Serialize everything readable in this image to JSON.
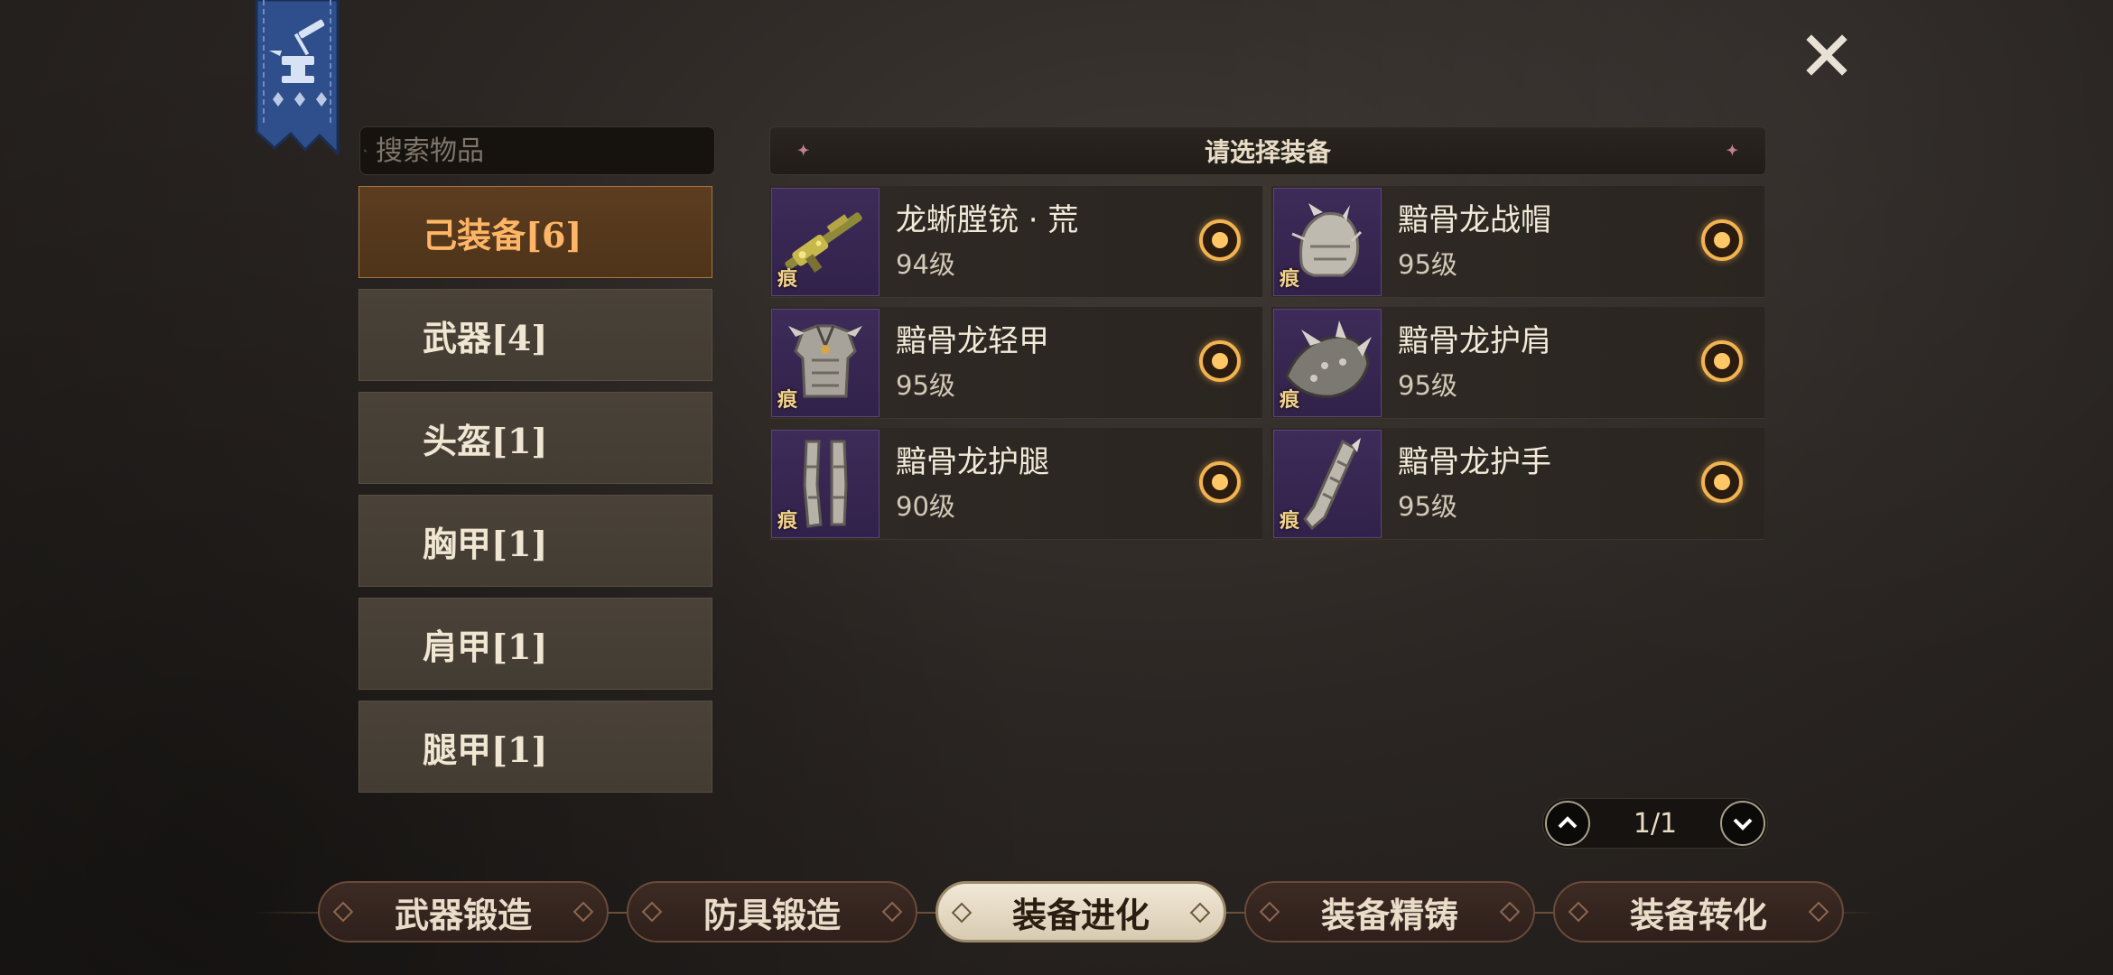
{
  "search": {
    "placeholder": "搜索物品"
  },
  "categories": [
    {
      "label": "己装备[6]",
      "active": true
    },
    {
      "label": "武器[4]",
      "active": false
    },
    {
      "label": "头盔[1]",
      "active": false
    },
    {
      "label": "胸甲[1]",
      "active": false
    },
    {
      "label": "肩甲[1]",
      "active": false
    },
    {
      "label": "腿甲[1]",
      "active": false
    }
  ],
  "list": {
    "header": "请选择装备",
    "items": [
      {
        "name": "龙蜥膛铳 · 荒",
        "level": "94级",
        "mark": "痕",
        "icon": "rifle-icon"
      },
      {
        "name": "黯骨龙战帽",
        "level": "95级",
        "mark": "痕",
        "icon": "helmet-icon"
      },
      {
        "name": "黯骨龙轻甲",
        "level": "95级",
        "mark": "痕",
        "icon": "chest-armor-icon"
      },
      {
        "name": "黯骨龙护肩",
        "level": "95级",
        "mark": "痕",
        "icon": "pauldron-icon"
      },
      {
        "name": "黯骨龙护腿",
        "level": "90级",
        "mark": "痕",
        "icon": "leg-armor-icon"
      },
      {
        "name": "黯骨龙护手",
        "level": "95级",
        "mark": "痕",
        "icon": "gauntlet-icon"
      }
    ]
  },
  "pager": {
    "text": "1/1"
  },
  "tabs": [
    {
      "label": "武器锻造",
      "active": false
    },
    {
      "label": "防具锻造",
      "active": false
    },
    {
      "label": "装备进化",
      "active": true
    },
    {
      "label": "装备精铸",
      "active": false
    },
    {
      "label": "装备转化",
      "active": false
    }
  ],
  "colors": {
    "accent": "#f2b350",
    "active_category_text": "#ffb566",
    "item_thumb_bg": "#3e2b59",
    "banner": "#3d5e9c"
  }
}
